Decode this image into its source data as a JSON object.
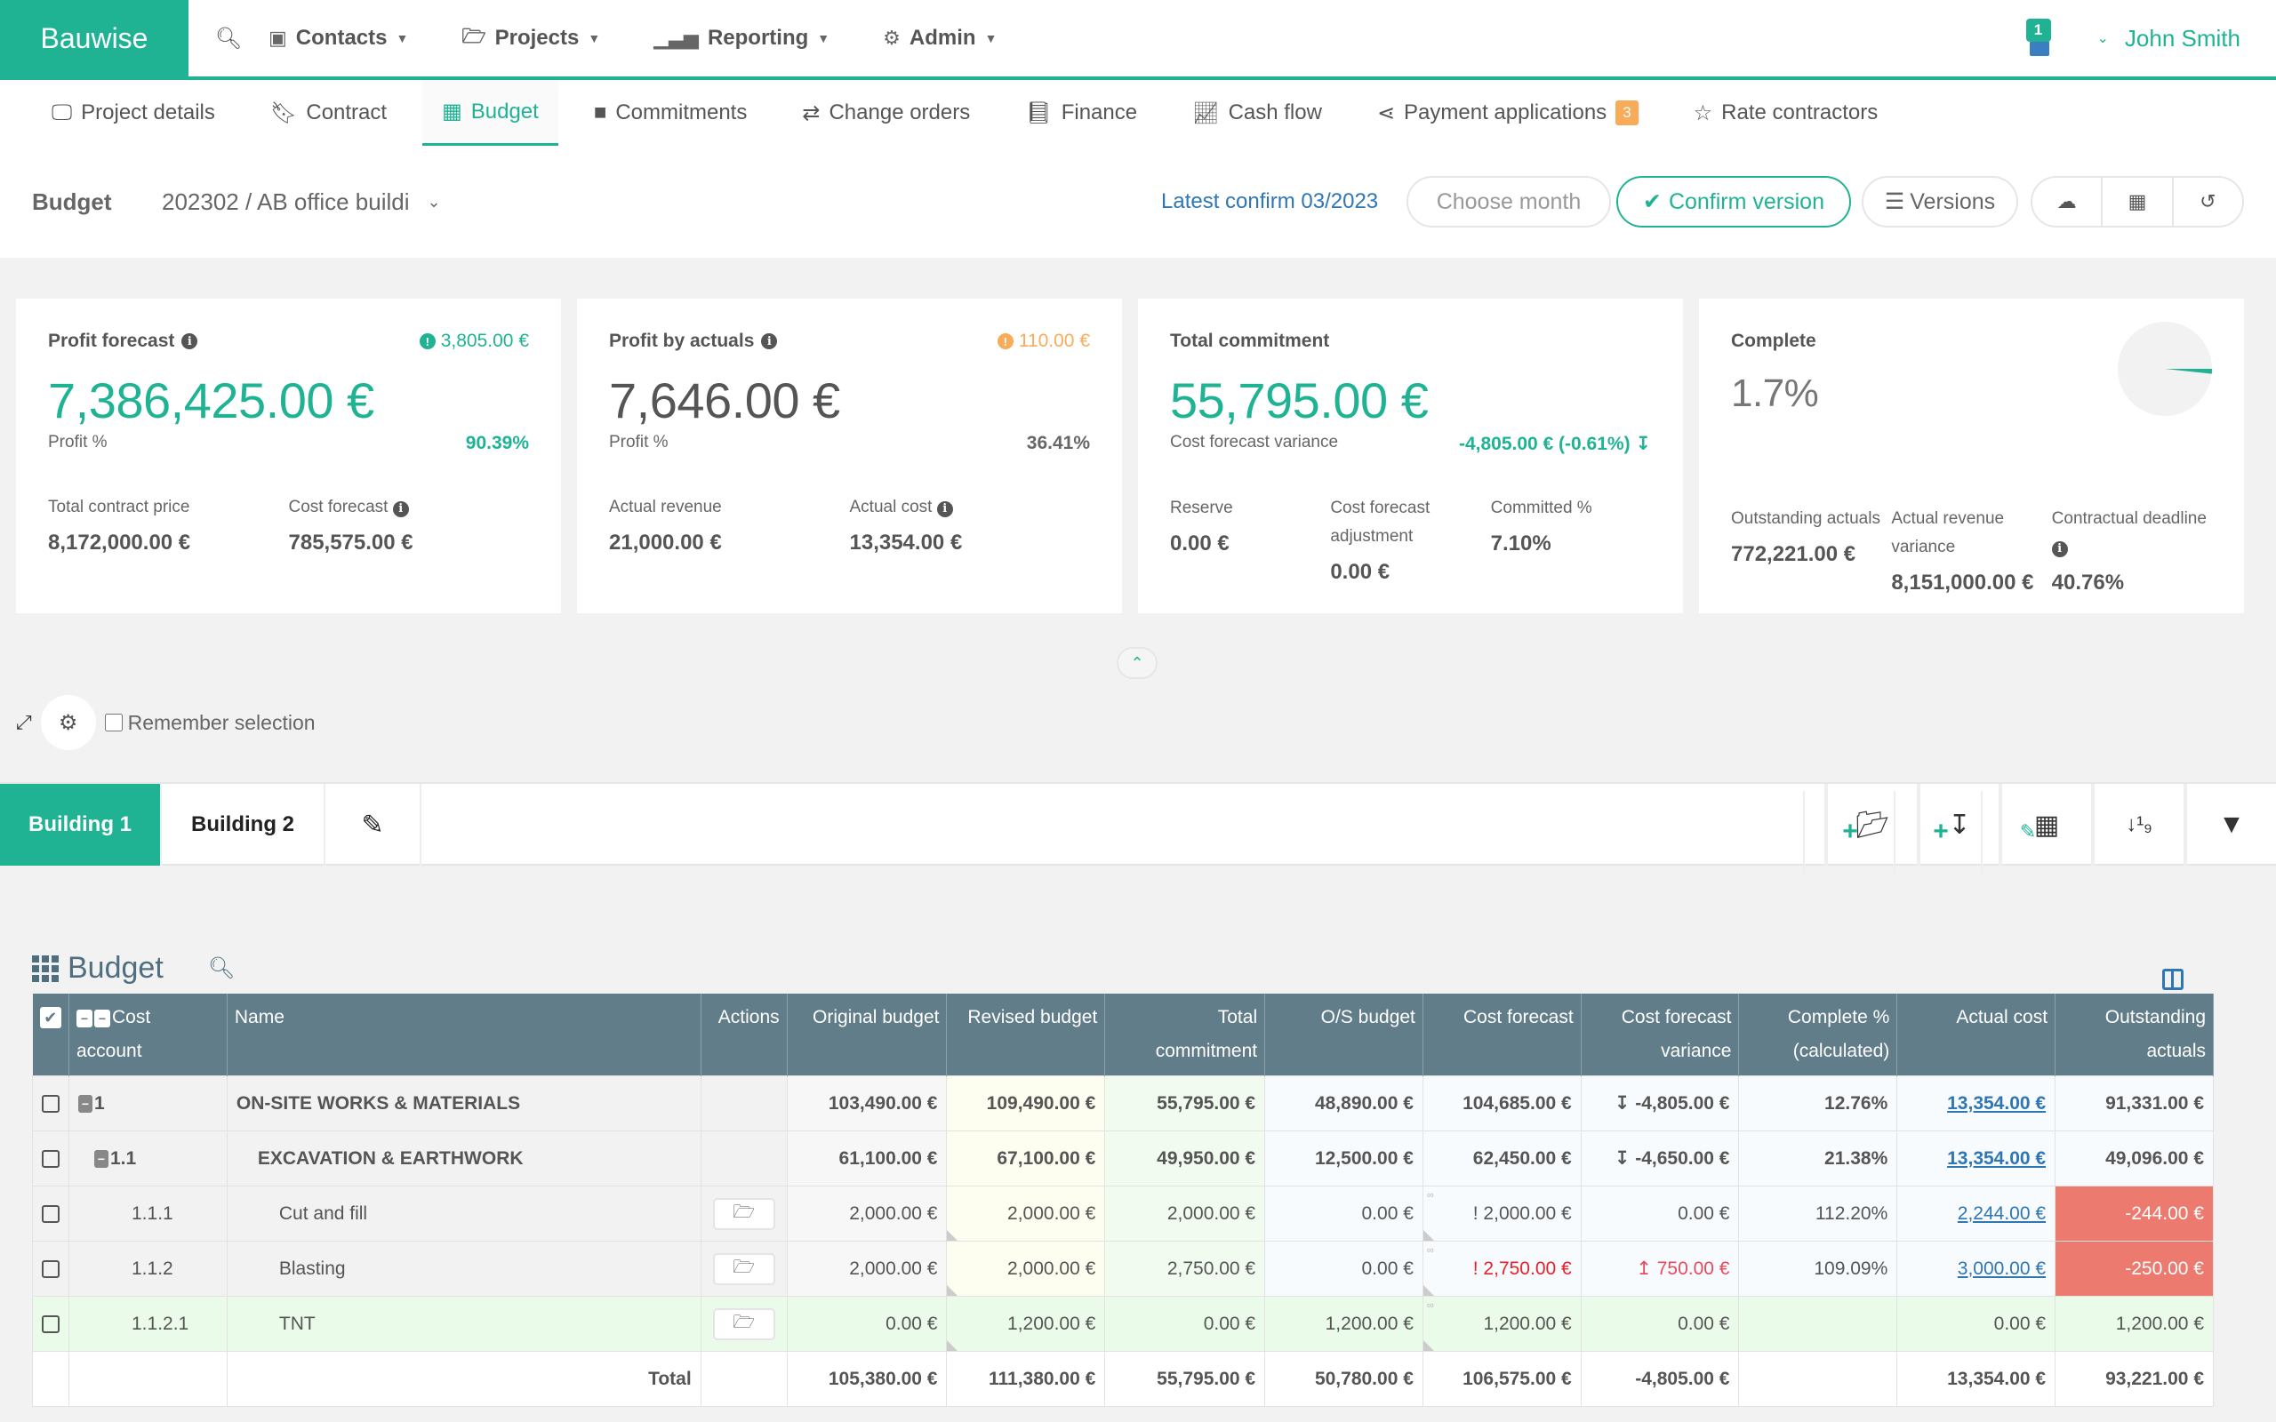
{
  "app": {
    "brand": "Bauwise",
    "nav": [
      {
        "icon": "contact-card-icon",
        "glyph": "▣",
        "label": "Contacts"
      },
      {
        "icon": "folder-open-icon",
        "glyph": "🗁",
        "label": "Projects"
      },
      {
        "icon": "bar-chart-icon",
        "glyph": "📊",
        "label": "Reporting"
      },
      {
        "icon": "gear-icon",
        "glyph": "⚙",
        "label": "Admin"
      }
    ],
    "notifications_count": "1",
    "user_name": "John Smith"
  },
  "tabs": [
    {
      "icon": "monitor-icon",
      "glyph": "🖵",
      "label": "Project details"
    },
    {
      "icon": "bookmark-icon",
      "glyph": "🔖",
      "label": "Contract"
    },
    {
      "icon": "calculator-icon",
      "glyph": "▦",
      "label": "Budget",
      "active": true
    },
    {
      "icon": "archive-icon",
      "glyph": "🗄",
      "label": "Commitments"
    },
    {
      "icon": "retweet-icon",
      "glyph": "⇄",
      "label": "Change orders"
    },
    {
      "icon": "book-icon",
      "glyph": "📘",
      "label": "Finance"
    },
    {
      "icon": "line-chart-icon",
      "glyph": "📈",
      "label": "Cash flow"
    },
    {
      "icon": "share-icon",
      "glyph": "⋖",
      "label": "Payment applications",
      "badge": "3"
    },
    {
      "icon": "star-half-icon",
      "glyph": "☆",
      "label": "Rate contractors"
    }
  ],
  "budget_bar": {
    "label": "Budget",
    "project": "202302 / AB office buildi",
    "latest_confirm": "Latest confirm 03/2023",
    "choose_month_placeholder": "Choose month",
    "confirm_label": "Confirm version",
    "versions_label": "Versions"
  },
  "cards": {
    "profit_forecast": {
      "title": "Profit forecast",
      "corner": "3,805.00 €",
      "value": "7,386,425.00 €",
      "sub_label": "Profit %",
      "sub_value": "90.39%",
      "items": [
        {
          "label": "Total contract price",
          "value": "8,172,000.00 €"
        },
        {
          "label": "Cost forecast",
          "value": "785,575.00 €"
        }
      ]
    },
    "profit_actuals": {
      "title": "Profit by actuals",
      "corner": "110.00 €",
      "value": "7,646.00 €",
      "sub_label": "Profit %",
      "sub_value": "36.41%",
      "items": [
        {
          "label": "Actual revenue",
          "value": "21,000.00 €"
        },
        {
          "label": "Actual cost",
          "value": "13,354.00 €"
        }
      ]
    },
    "total_commitment": {
      "title": "Total commitment",
      "value": "55,795.00 €",
      "sub_label": "Cost forecast variance",
      "sub_value": "-4,805.00 € (-0.61%) ↧",
      "items": [
        {
          "label": "Reserve",
          "value": "0.00 €"
        },
        {
          "label": "Cost forecast adjustment",
          "value": "0.00 €"
        },
        {
          "label": "Committed %",
          "value": "7.10%"
        }
      ]
    },
    "complete": {
      "title": "Complete",
      "value": "1.7%",
      "complete_fraction": 0.017,
      "items": [
        {
          "label": "Outstanding actuals",
          "value": "772,221.00 €"
        },
        {
          "label": "Actual revenue variance",
          "value": "8,151,000.00 €"
        },
        {
          "label": "Contractual deadline",
          "value": "40.76%"
        }
      ]
    }
  },
  "tools": {
    "remember_selection": "Remember selection"
  },
  "building_tabs": [
    "Building 1",
    "Building 2"
  ],
  "grid": {
    "title": "Budget",
    "columns": [
      "Cost account",
      "Name",
      "Actions",
      "Original budget",
      "Revised budget",
      "Total commitment",
      "O/S budget",
      "Cost forecast",
      "Cost forecast variance",
      "Complete % (calculated)",
      "Actual cost",
      "Outstanding actuals"
    ],
    "rows": [
      {
        "account": "1",
        "name": "ON-SITE WORKS & MATERIALS",
        "level": 0,
        "bold": true,
        "orig": "103,490.00 €",
        "rev": "109,490.00 €",
        "comm": "55,795.00 €",
        "os": "48,890.00 €",
        "cf": "104,685.00 €",
        "var": "↧ -4,805.00 €",
        "var_color": "teal",
        "pct": "12.76%",
        "actual": "13,354.00 €",
        "out": "91,331.00 €"
      },
      {
        "account": "1.1",
        "name": "EXCAVATION & EARTHWORK",
        "level": 1,
        "bold": true,
        "orig": "61,100.00 €",
        "rev": "67,100.00 €",
        "comm": "49,950.00 €",
        "os": "12,500.00 €",
        "cf": "62,450.00 €",
        "var": "↧ -4,650.00 €",
        "var_color": "teal",
        "pct": "21.38%",
        "actual": "13,354.00 €",
        "out": "49,096.00 €"
      },
      {
        "account": "1.1.1",
        "name": "Cut and fill",
        "level": 2,
        "orig": "2,000.00 €",
        "rev": "2,000.00 €",
        "comm": "2,000.00 €",
        "os": "0.00 €",
        "cf": "! 2,000.00 €",
        "var": "0.00 €",
        "pct": "112.20%",
        "actual": "2,244.00 €",
        "out": "-244.00 €",
        "out_danger": true
      },
      {
        "account": "1.1.2",
        "name": "Blasting",
        "level": 2,
        "orig": "2,000.00 €",
        "rev": "2,000.00 €",
        "comm": "2,750.00 €",
        "os": "0.00 €",
        "cf": "! 2,750.00 €",
        "cf_color": "red",
        "var": "↥ 750.00 €",
        "var_color": "pink",
        "pct": "109.09%",
        "actual": "3,000.00 €",
        "out": "-250.00 €",
        "out_danger": true
      },
      {
        "account": "1.1.2.1",
        "name": "TNT",
        "level": 2,
        "green": true,
        "orig": "0.00 €",
        "rev": "1,200.00 €",
        "comm": "0.00 €",
        "os": "1,200.00 €",
        "cf": "1,200.00 €",
        "var": "0.00 €",
        "pct": "",
        "actual": "0.00 €",
        "out": "1,200.00 €"
      }
    ],
    "total": {
      "label": "Total",
      "orig": "105,380.00 €",
      "rev": "111,380.00 €",
      "comm": "55,795.00 €",
      "os": "50,780.00 €",
      "cf": "106,575.00 €",
      "var": "-4,805.00 €",
      "pct": "",
      "actual": "13,354.00 €",
      "out": "93,221.00 €"
    }
  }
}
